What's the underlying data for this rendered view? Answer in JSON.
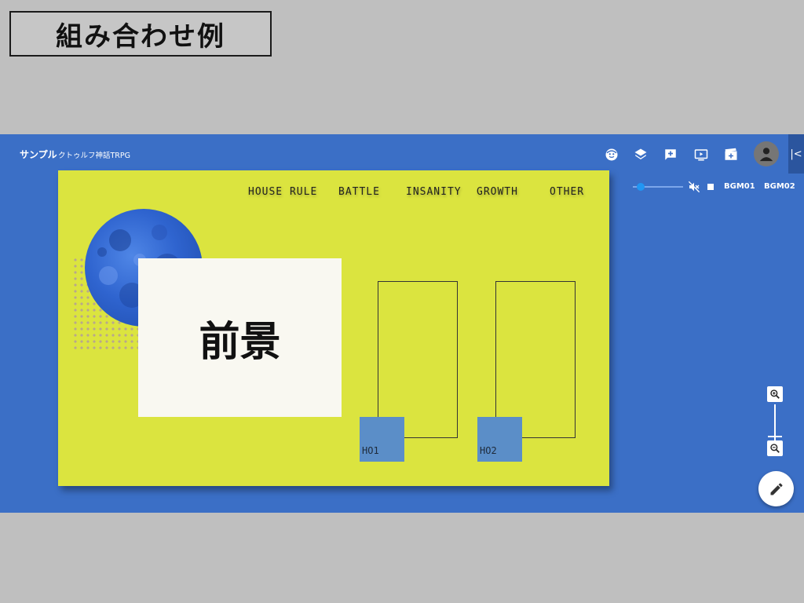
{
  "slide": {
    "title": "組み合わせ例"
  },
  "appbar": {
    "room_name": "サンプル",
    "system_name": "クトゥルフ神話TRPG",
    "icons": [
      "face-icon",
      "layers-icon",
      "add-box-icon",
      "screen-icon",
      "movie-icon",
      "account-icon",
      "collapse-drawer-icon"
    ],
    "collapse_label": "|<"
  },
  "bgm": {
    "volume": 0.15,
    "track1": "BGM01",
    "track2": "BGM02"
  },
  "board": {
    "nav": [
      "HOUSE RULE",
      "BATTLE",
      "INSANITY",
      "GROWTH",
      "OTHER"
    ],
    "foreground_label": "前景",
    "tokens": [
      "HO1",
      "HO2"
    ]
  },
  "colors": {
    "app_background": "#3b6fc6",
    "board_background": "#dbe43f",
    "token": "#5b8ec8",
    "page_background": "#bfbfbf"
  }
}
